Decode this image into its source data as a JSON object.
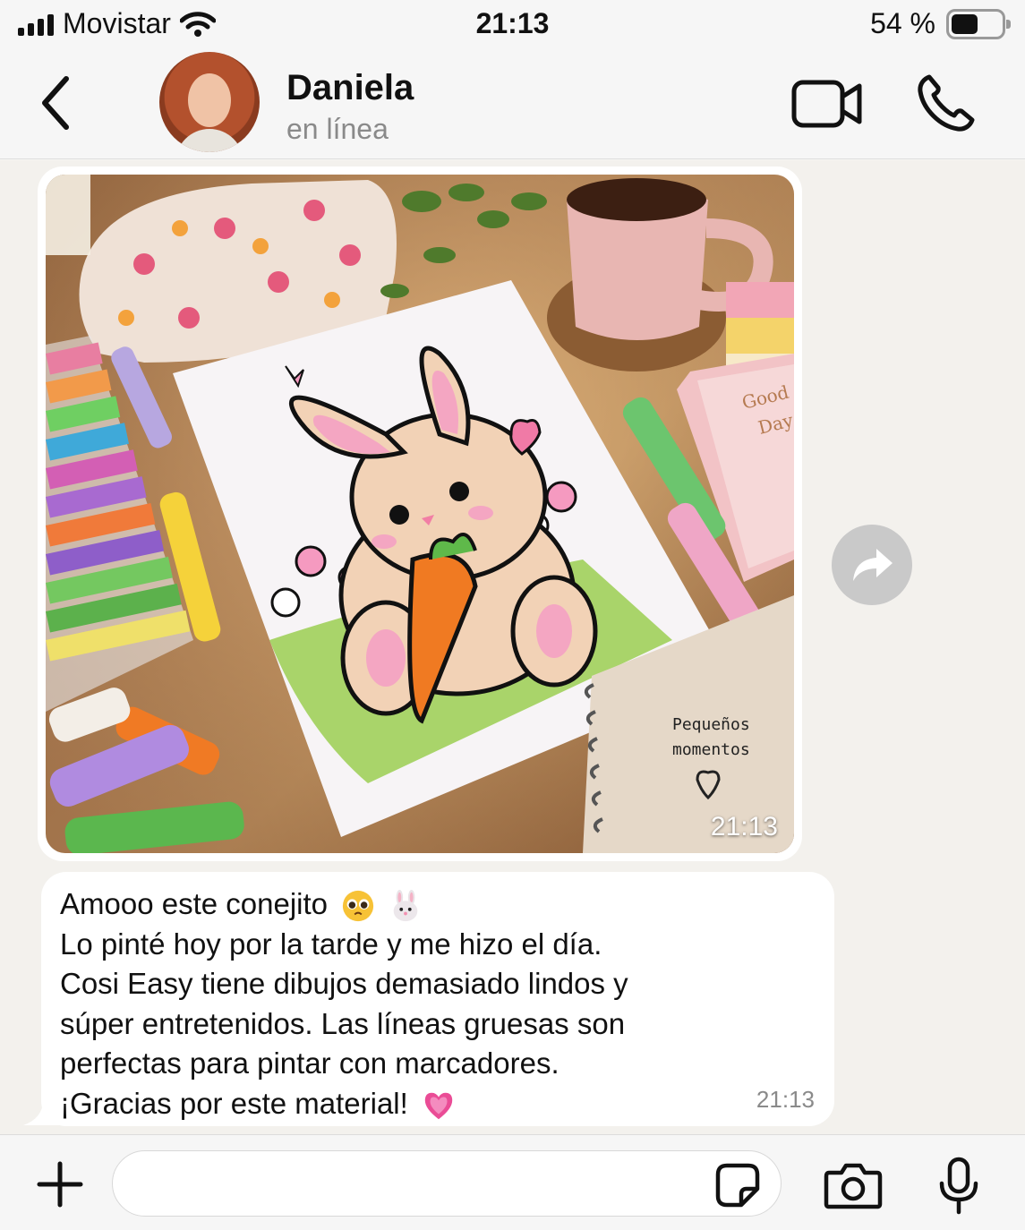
{
  "status_bar": {
    "carrier": "Movistar",
    "time": "21:13",
    "battery_percent": "54 %",
    "battery_level": 0.54
  },
  "header": {
    "contact_name": "Daniela",
    "contact_status": "en línea"
  },
  "messages": [
    {
      "type": "image",
      "time": "21:13",
      "description_icons": [
        "photo"
      ]
    },
    {
      "type": "text",
      "lines": [
        "Amooo este conejito",
        "Lo pinté hoy por la tarde y me hizo el día.",
        "Cosi Easy tiene dibujos demasiado lindos y",
        "súper entretenidos. Las líneas gruesas son",
        "perfectas para pintar con marcadores.",
        "¡Gracias por este material!"
      ],
      "time": "21:13"
    }
  ],
  "photo_text": {
    "notebook_line1": "Pequeños",
    "notebook_line2": "momentos",
    "book_line1": "Good",
    "book_line2": "Day"
  },
  "composer": {
    "placeholder": ""
  },
  "colors": {
    "accent": "#111111",
    "bubble": "#ffffff",
    "chat_bg": "#f3f1ed",
    "muted": "#8a8a8a"
  },
  "icons": [
    "back-chevron-icon",
    "video-camera-icon",
    "phone-icon",
    "forward-icon",
    "plus-icon",
    "sticker-icon",
    "camera-icon",
    "microphone-icon",
    "wifi-icon",
    "signal-icon",
    "battery-icon"
  ]
}
